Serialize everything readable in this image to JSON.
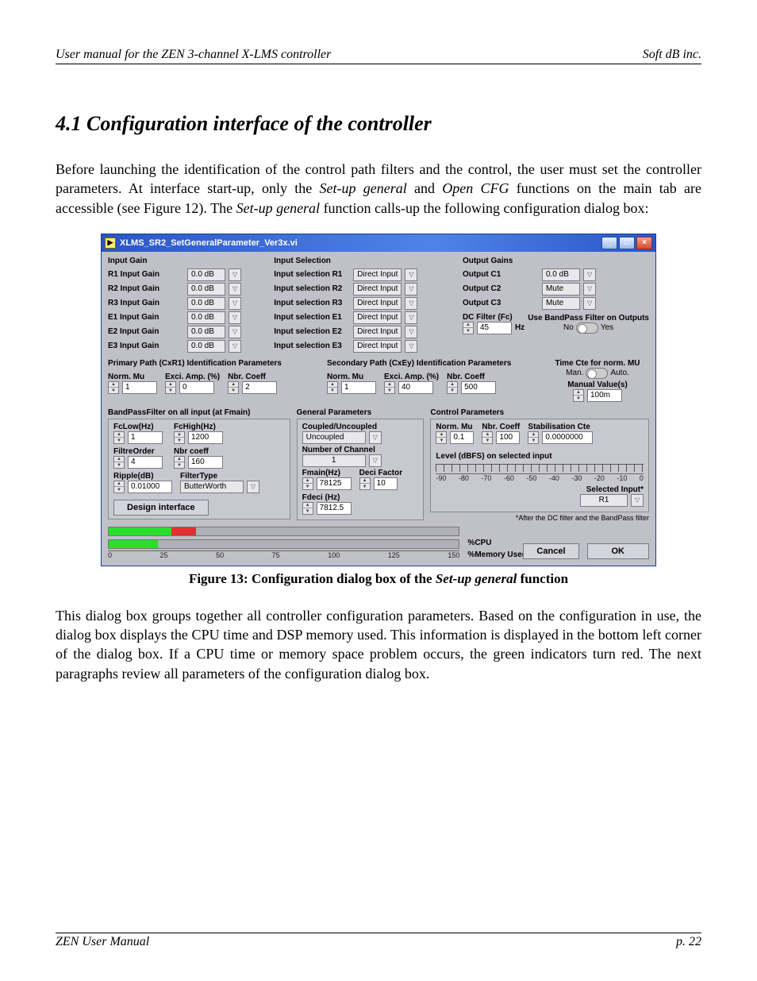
{
  "header": {
    "left": "User manual for the ZEN 3-channel X-LMS controller",
    "right": "Soft dB inc."
  },
  "section_title": "4.1 Configuration interface of the controller",
  "para1_a": "Before launching the identification of the control path filters and the control, the user must set the controller parameters. At interface start-up, only the ",
  "para1_i1": "Set-up general",
  "para1_b": " and ",
  "para1_i2": "Open CFG",
  "para1_c": " functions on the main tab are accessible (see Figure 12). The ",
  "para1_i3": "Set-up general",
  "para1_d": " function calls-up the following configuration dialog box:",
  "window": {
    "title": "XLMS_SR2_SetGeneralParameter_Ver3x.vi",
    "input_gain_header": "Input Gain",
    "input_selection_header": "Input Selection",
    "output_gains_header": "Output Gains",
    "input_gains": [
      {
        "label": "R1 Input Gain",
        "val": "0.0 dB"
      },
      {
        "label": "R2 Input Gain",
        "val": "0.0 dB"
      },
      {
        "label": "R3 Input Gain",
        "val": "0.0 dB"
      },
      {
        "label": "E1 Input Gain",
        "val": "0.0 dB"
      },
      {
        "label": "E2 Input Gain",
        "val": "0.0 dB"
      },
      {
        "label": "E3 Input Gain",
        "val": "0.0 dB"
      }
    ],
    "input_sel": [
      {
        "label": "Input selection R1",
        "val": "Direct Input"
      },
      {
        "label": "Input selection R2",
        "val": "Direct Input"
      },
      {
        "label": "Input selection R3",
        "val": "Direct Input"
      },
      {
        "label": "Input selection E1",
        "val": "Direct Input"
      },
      {
        "label": "Input selection E2",
        "val": "Direct Input"
      },
      {
        "label": "Input selection E3",
        "val": "Direct Input"
      }
    ],
    "outputs": [
      {
        "label": "Output C1",
        "val": "0.0 dB"
      },
      {
        "label": "Output C2",
        "val": "Mute"
      },
      {
        "label": "Output C3",
        "val": "Mute"
      }
    ],
    "dc_filter_label": "DC Filter (Fc)",
    "dc_filter_val": "45",
    "dc_filter_unit": "Hz",
    "use_bandpass": "Use BandPass Filter on Outputs",
    "no": "No",
    "yes": "Yes",
    "time_cte": "Time Cte for norm. MU",
    "timecte_man": "Man.",
    "timecte_auto": "Auto.",
    "manual_values": "Manual Value(s)",
    "manual_val": "100m",
    "primary_header": "Primary Path (CxR1) Identification Parameters",
    "secondary_header": "Secondary Path (CxEy) Identification Parameters",
    "norm_mu": "Norm. Mu",
    "exci_amp": "Exci. Amp. (%)",
    "nbr_coeff": "Nbr. Coeff",
    "primary_norm_mu": "1",
    "primary_exci": "0",
    "primary_nbr": "2",
    "secondary_norm_mu": "1",
    "secondary_exci": "40",
    "secondary_nbr": "500",
    "bp_header": "BandPassFilter on all input (at Fmain)",
    "general_params": "General Parameters",
    "control_params": "Control Parameters",
    "fclow": "FcLow(Hz)",
    "fchigh": "FcHigh(Hz)",
    "fclow_v": "1",
    "fchigh_v": "1200",
    "filtre_order": "FiltreOrder",
    "nbr_coeff2": "Nbr coeff",
    "filtre_order_v": "4",
    "nbr_coeff2_v": "160",
    "ripple": "Ripple(dB)",
    "filter_type": "FilterType",
    "ripple_v": "0.01000",
    "filter_type_v": "ButterWorth",
    "design_interface": "Design interface",
    "coupled": "Coupled/Uncoupled",
    "coupled_v": "Uncoupled",
    "num_channel": "Number of Channel",
    "num_channel_v": "1",
    "fmain": "Fmain(Hz)",
    "deci": "Deci Factor",
    "fmain_v": "78125",
    "deci_v": "10",
    "fdeci": "Fdeci (Hz)",
    "fdeci_v": "7812.5",
    "ctrl_norm_mu": "Norm. Mu",
    "ctrl_nbr": "Nbr. Coeff",
    "ctrl_stab": "Stabilisation Cte",
    "ctrl_norm_mu_v": "0.1",
    "ctrl_nbr_v": "100",
    "ctrl_stab_v": "0.0000000",
    "level_label": "Level (dBFS) on selected input",
    "level_ticks": [
      "-90",
      "-80",
      "-70",
      "-60",
      "-50",
      "-40",
      "-30",
      "-20",
      "-10",
      "0"
    ],
    "selected_input": "Selected Input*",
    "selected_input_v": "R1",
    "selected_note": "*After the DC filter and the BandPass filter",
    "cpu": "%CPU",
    "mem": "%Memory Used",
    "scale": [
      "0",
      "25",
      "50",
      "75",
      "100",
      "125",
      "150"
    ],
    "cancel": "Cancel",
    "ok": "OK"
  },
  "figure_caption_a": "Figure 13: Configuration dialog box of the ",
  "figure_caption_i": "Set-up general",
  "figure_caption_b": " function",
  "para2": "This dialog box groups together all controller configuration parameters. Based on the configuration in use, the dialog box displays the CPU time and DSP memory used. This information is displayed in the bottom left corner of the dialog box. If a CPU time or memory space problem occurs, the green indicators turn red. The next paragraphs review all parameters of the configuration dialog box.",
  "footer": {
    "left": "ZEN User Manual",
    "right": "p. 22"
  }
}
